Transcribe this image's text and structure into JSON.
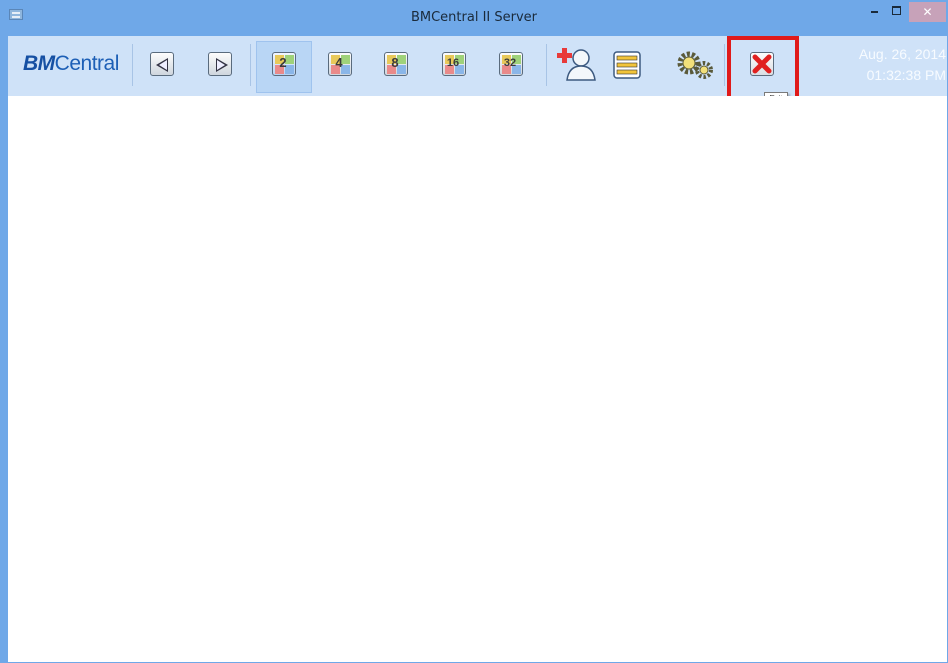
{
  "window": {
    "title": "BMCentral II Server",
    "controls": {
      "minimize": "minimize",
      "maximize": "maximize",
      "close": "close"
    }
  },
  "toolbar": {
    "logo": {
      "bold": "BM",
      "rest": "Central"
    },
    "buttons": {
      "prev": "previous-page-icon",
      "next": "next-page-icon",
      "grid_2": "2",
      "grid_4": "4",
      "grid_8": "8",
      "grid_16": "16",
      "grid_32": "32",
      "add_user": "add-user-icon",
      "list": "list-icon",
      "settings": "settings-icon",
      "exit": "exit-icon"
    },
    "datetime": {
      "date": "Aug. 26, 2014",
      "time": "01:32:38 PM"
    }
  },
  "tooltip": {
    "exit": "Exit"
  },
  "colors": {
    "titlebar": "#6fa8e8",
    "toolbar": "#cfe2f8",
    "highlight": "#e01a1a",
    "exit_icon": "#e02020"
  }
}
